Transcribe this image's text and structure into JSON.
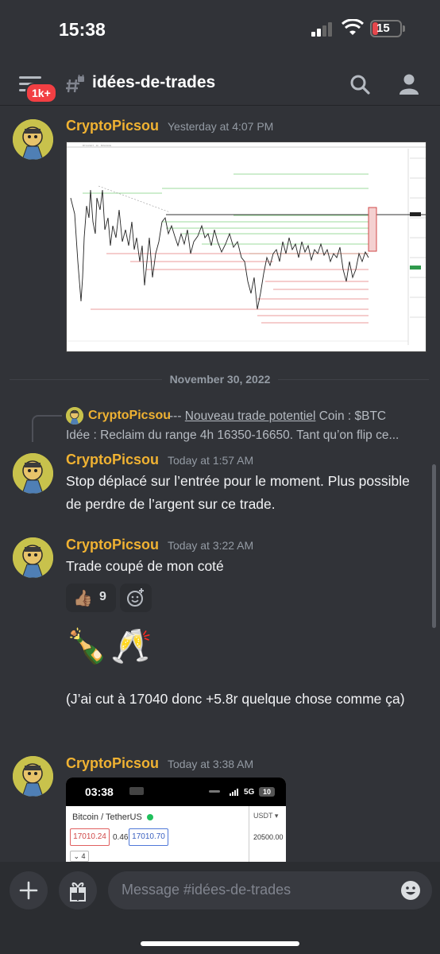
{
  "status_bar": {
    "time": "15:38",
    "battery": "15"
  },
  "header": {
    "badge": "1k+",
    "channel_name": "idées-de-trades"
  },
  "messages": [
    {
      "author": "CryptoPicsou",
      "timestamp": "Yesterday at 4:07 PM"
    },
    {
      "author": "CryptoPicsou",
      "timestamp": "Today at 1:57 AM",
      "text": "Stop déplacé sur l’entrée pour le moment. Plus possible de perdre de l’argent sur ce trade."
    },
    {
      "author": "CryptoPicsou",
      "timestamp": "Today at 3:22 AM",
      "text": "Trade coupé de mon coté",
      "reaction_emoji": "👍🏽",
      "reaction_count": "9",
      "emoji_line": "🍾🥂",
      "followup": "(J’ai cut à 17040 donc +5.8r quelque chose comme ça)"
    },
    {
      "author": "CryptoPicsou",
      "timestamp": "Today at 3:38 AM"
    }
  ],
  "date_divider": "November 30, 2022",
  "reply": {
    "author": "CryptoPicsou",
    "prefix": "--- ",
    "link": "Nouveau trade potentiel",
    "suffix": " Coin : $BTC",
    "line2": "Idée : Reclaim du range 4h 16350-16650. Tant qu’on flip ce..."
  },
  "screenshot_preview": {
    "time": "03:38",
    "network": "5G",
    "battery": "10",
    "pair": "Bitcoin / TetherUS",
    "currency": "USDT",
    "bid": "17010.24",
    "spread": "0.46",
    "ask": "17010.70",
    "price": "20500.00",
    "qty": "4"
  },
  "composer": {
    "placeholder": "Message #idées-de-trades"
  },
  "colors": {
    "background": "#313338",
    "author": "#f0b232",
    "badge": "#f23f43"
  }
}
